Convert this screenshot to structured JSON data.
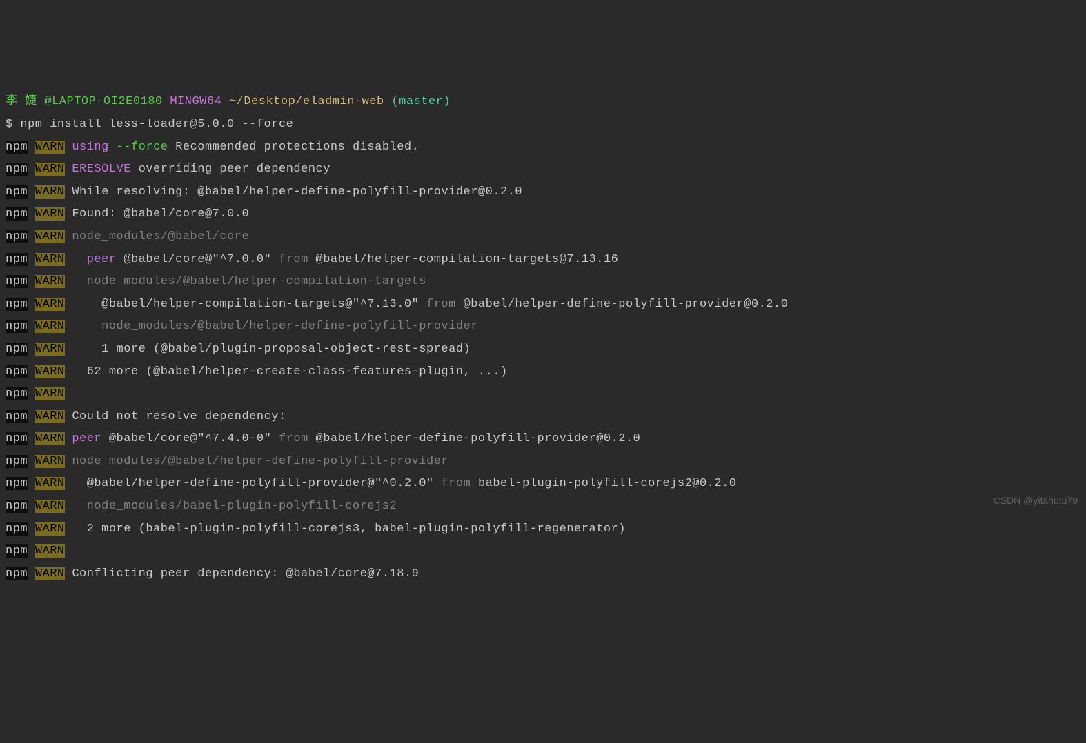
{
  "prompt": {
    "user": "李 婕",
    "host": "@LAPTOP-OI2E0180",
    "shell": "MINGW64",
    "path": "~/Desktop/eladmin-web",
    "branch": "(master)",
    "symbol": "$",
    "command": "npm install less-loader@5.0.0 --force"
  },
  "npm": "npm",
  "warn": "WARN",
  "lines": {
    "l1_using": "using",
    "l1_force": "--force",
    "l1_rest": "Recommended protections disabled.",
    "l2_eresolve": "ERESOLVE",
    "l2_rest": "overriding peer dependency",
    "l3": "While resolving: @babel/helper-define-polyfill-provider@0.2.0",
    "l4": "Found: @babel/core@7.0.0",
    "l5": "node_modules/@babel/core",
    "l6_peer": "peer",
    "l6_pkg": "@babel/core@\"^7.0.0\"",
    "l6_from": "from",
    "l6_rest": "@babel/helper-compilation-targets@7.13.16",
    "l7": "node_modules/@babel/helper-compilation-targets",
    "l8_pkg": "@babel/helper-compilation-targets@\"^7.13.0\"",
    "l8_from": "from",
    "l8_rest": "@babel/helper-define-polyfill-provider@0.2.0",
    "l9": "node_modules/@babel/helper-define-polyfill-provider",
    "l10": "1 more (@babel/plugin-proposal-object-rest-spread)",
    "l11": "62 more (@babel/helper-create-class-features-plugin, ...)",
    "l12": "",
    "l13": "Could not resolve dependency:",
    "l14_peer": "peer",
    "l14_pkg": "@babel/core@\"^7.4.0-0\"",
    "l14_from": "from",
    "l14_rest": "@babel/helper-define-polyfill-provider@0.2.0",
    "l15": "node_modules/@babel/helper-define-polyfill-provider",
    "l16_pkg": "@babel/helper-define-polyfill-provider@\"^0.2.0\"",
    "l16_from": "from",
    "l16_rest": "babel-plugin-polyfill-corejs2@0.2.0",
    "l17": "node_modules/babel-plugin-polyfill-corejs2",
    "l18": "2 more (babel-plugin-polyfill-corejs3, babel-plugin-polyfill-regenerator)",
    "l19": "",
    "l20": "Conflicting peer dependency: @babel/core@7.18.9"
  },
  "watermark": "CSDN @yitahutu79"
}
